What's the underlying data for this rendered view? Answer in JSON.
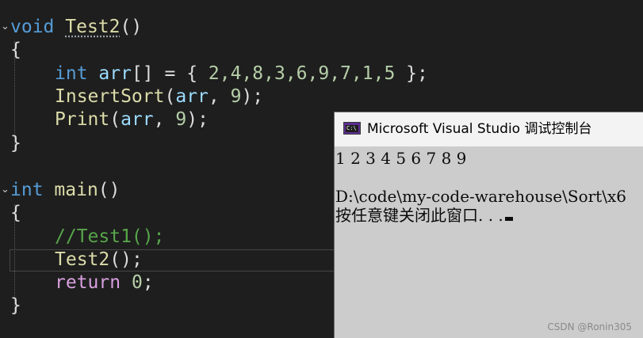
{
  "editor": {
    "lines": [
      {
        "tokens": [
          "void",
          "Test2",
          "()"
        ]
      },
      {
        "tokens": [
          "{"
        ]
      },
      {
        "tokens": [
          "int",
          "arr",
          "[] = { ",
          "2,4,8,3,6,9,7,1,5",
          " };"
        ]
      },
      {
        "tokens": [
          "InsertSort",
          "(",
          "arr",
          ", ",
          "9",
          ");"
        ]
      },
      {
        "tokens": [
          "Print",
          "(",
          "arr",
          ", ",
          "9",
          ");"
        ]
      },
      {
        "tokens": [
          "}"
        ]
      },
      {
        "tokens": [
          "int",
          "main",
          "()"
        ]
      },
      {
        "tokens": [
          "{"
        ]
      },
      {
        "tokens": [
          "//Test1();"
        ]
      },
      {
        "tokens": [
          "Test2",
          "();"
        ]
      },
      {
        "tokens": [
          "return",
          "0",
          ";"
        ]
      },
      {
        "tokens": [
          "}"
        ]
      }
    ]
  },
  "console": {
    "title": "Microsoft Visual Studio 调试控制台",
    "icon_label": "C:\\",
    "output": [
      "1 2 3 4 5 6 7 8 9",
      "",
      "D:\\code\\my-code-warehouse\\Sort\\x6",
      "按任意键关闭此窗口. . ."
    ]
  },
  "watermark": "CSDN @Ronin305",
  "colors": {
    "editor_bg": "#1e1e1e",
    "keyword": "#569cd6",
    "control_keyword": "#d8a0df",
    "function": "#dcdcaa",
    "variable": "#9cdcfe",
    "number": "#b5cea8",
    "comment": "#57a64a",
    "console_bg": "#cccccc"
  }
}
